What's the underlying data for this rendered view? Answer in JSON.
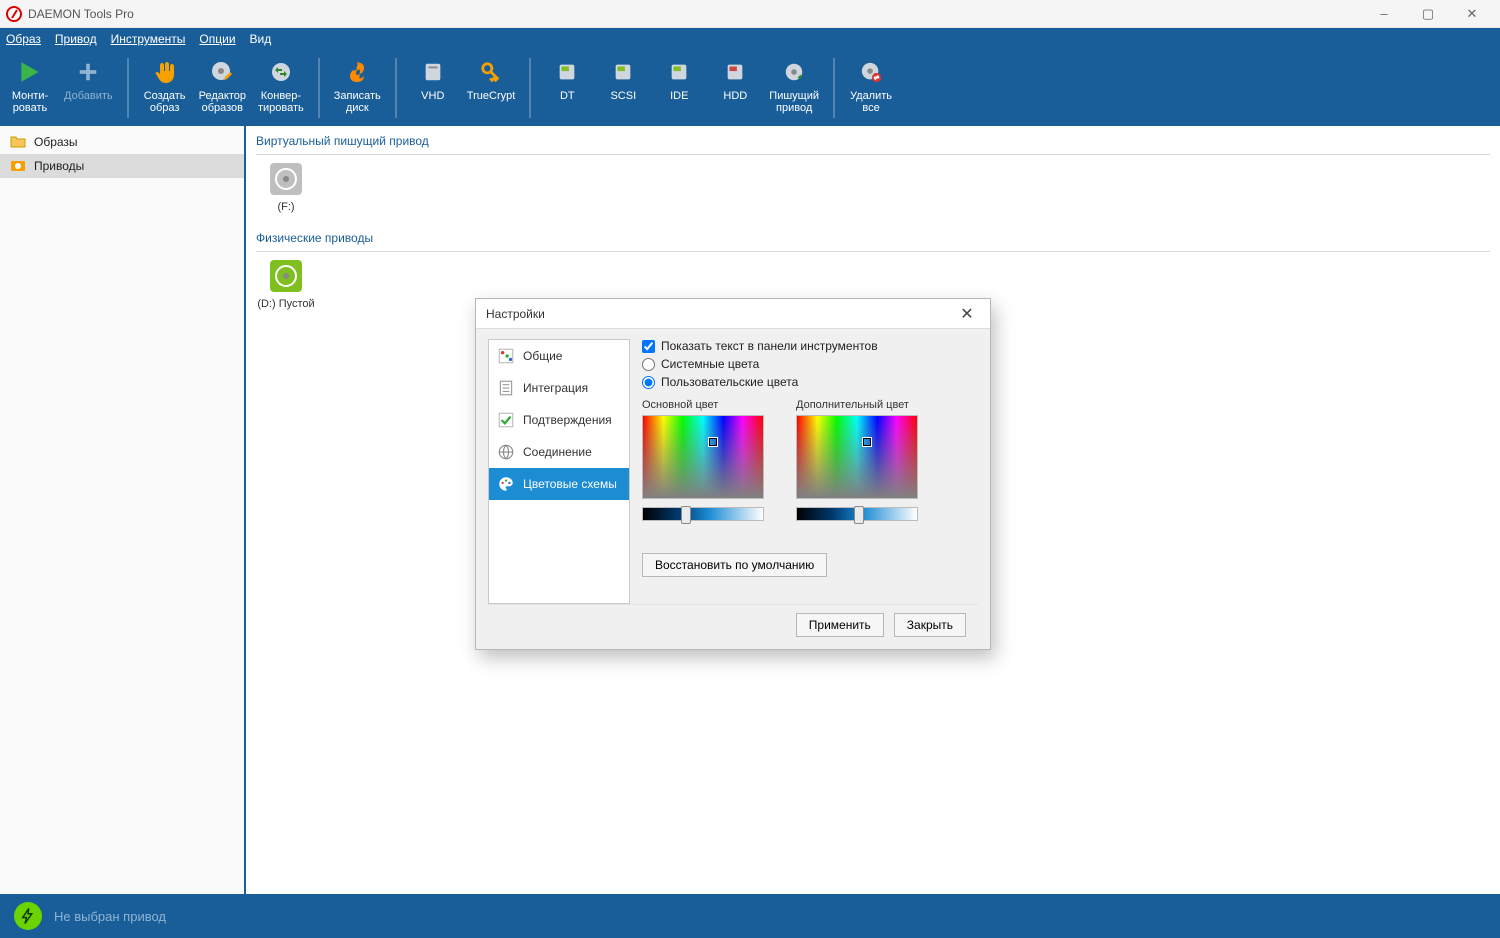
{
  "window": {
    "title": "DAEMON Tools Pro",
    "controls": {
      "minimize": "–",
      "maximize": "▢",
      "close": "✕"
    }
  },
  "menu": {
    "items": [
      "Образ",
      "Привод",
      "Инструменты",
      "Опции",
      "Вид"
    ]
  },
  "toolbar": {
    "mount": {
      "l1": "Монти-",
      "l2": "ровать"
    },
    "add": {
      "l1": "Добавить",
      "l2": ""
    },
    "create_image": {
      "l1": "Создать",
      "l2": "образ"
    },
    "image_editor": {
      "l1": "Редактор",
      "l2": "образов"
    },
    "convert": {
      "l1": "Конвер-",
      "l2": "тировать"
    },
    "burn": {
      "l1": "Записать",
      "l2": "диск"
    },
    "vhd": {
      "l1": "VHD",
      "l2": ""
    },
    "truecrypt": {
      "l1": "TrueCrypt",
      "l2": ""
    },
    "dt": {
      "l1": "DT",
      "l2": ""
    },
    "scsi": {
      "l1": "SCSI",
      "l2": ""
    },
    "ide": {
      "l1": "IDE",
      "l2": ""
    },
    "hdd": {
      "l1": "HDD",
      "l2": ""
    },
    "writer": {
      "l1": "Пишущий",
      "l2": "привод"
    },
    "remove_all": {
      "l1": "Удалить",
      "l2": "все"
    }
  },
  "sidebar": {
    "images": "Образы",
    "drives": "Приводы"
  },
  "main": {
    "virtual_writer_section": "Виртуальный пишущий привод",
    "virtual_drive_label": "(F:)",
    "physical_section": "Физические приводы",
    "physical_drive_label": "(D:) Пустой"
  },
  "status": {
    "text": "Не выбран привод"
  },
  "dialog": {
    "title": "Настройки",
    "close": "✕",
    "nav": {
      "general": "Общие",
      "integration": "Интеграция",
      "confirmations": "Подтверждения",
      "connection": "Соединение",
      "color_schemes": "Цветовые схемы"
    },
    "options": {
      "show_text": "Показать текст в панели инструментов",
      "system_colors": "Системные цвета",
      "user_colors": "Пользовательские цвета"
    },
    "picker_primary_label": "Основной цвет",
    "picker_secondary_label": "Дополнительный цвет",
    "restore_default": "Восстановить по умолчанию",
    "apply": "Применить",
    "close_btn": "Закрыть"
  },
  "colors": {
    "brand_blue": "#195e99",
    "accent_blue": "#1c8cd3"
  }
}
